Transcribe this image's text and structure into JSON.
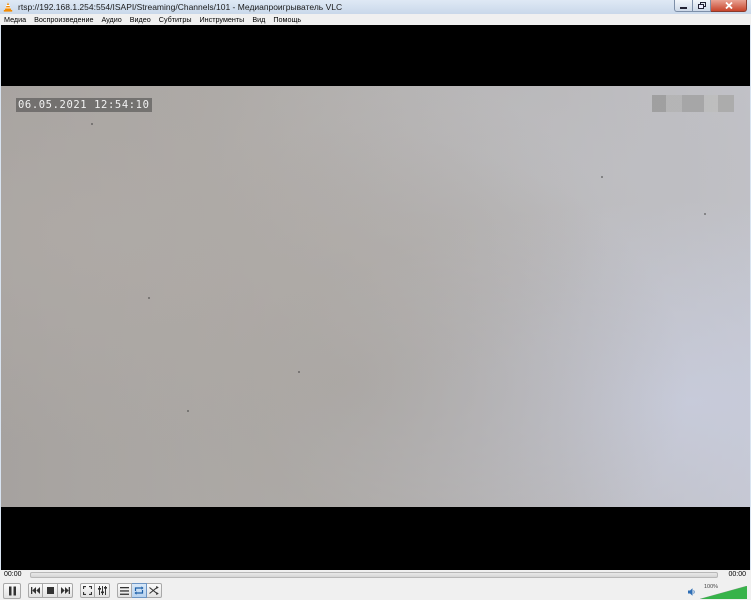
{
  "window": {
    "title": "rtsp://192.168.1.254:554/ISAPI/Streaming/Channels/101 - Медиапроигрыватель VLC",
    "minimize_icon": "minimize-icon",
    "maximize_icon": "maximize-icon",
    "close_icon": "close-icon"
  },
  "menu": {
    "items": [
      "Медиа",
      "Воспроизведение",
      "Аудио",
      "Видео",
      "Субтитры",
      "Инструменты",
      "Вид",
      "Помощь"
    ]
  },
  "video": {
    "osd_timestamp": "06.05.2021 12:54:10"
  },
  "controls": {
    "time_elapsed": "00:00",
    "time_total": "00:00",
    "seek_progress": 0,
    "volume_percent_label": "100%",
    "volume_level": 1.0,
    "icons": {
      "pause": "pause-icon",
      "previous": "previous-icon",
      "stop": "stop-icon",
      "next": "next-icon",
      "fullscreen": "fullscreen-icon",
      "extended_settings": "extended-settings-icon",
      "playlist": "playlist-icon",
      "loop": "loop-icon",
      "shuffle": "shuffle-icon",
      "speaker": "speaker-icon"
    }
  },
  "colors": {
    "accent": "#2d6db5",
    "volume_green": "#37b34a",
    "close_red": "#c8452c"
  }
}
